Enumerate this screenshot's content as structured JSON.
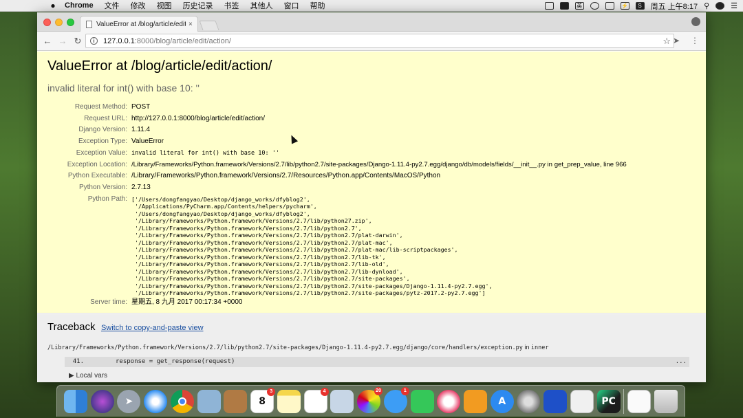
{
  "menubar": {
    "app": "Chrome",
    "items": [
      "文件",
      "修改",
      "视图",
      "历史记录",
      "书签",
      "其他人",
      "窗口",
      "帮助"
    ],
    "tray_ime": "英",
    "tray_battery": "⚡",
    "tray_s": "S",
    "clock": "周五 上午8:17"
  },
  "browser": {
    "tab_title": "ValueError at /blog/article/edit/",
    "tab_close": "×",
    "url_host": "127.0.0.1",
    "url_path": ":8000/blog/article/edit/action/"
  },
  "error": {
    "title": "ValueError at /blog/article/edit/action/",
    "subtitle": "invalid literal for int() with base 10: ''",
    "meta": [
      {
        "label": "Request Method:",
        "value": "POST"
      },
      {
        "label": "Request URL:",
        "value": "http://127.0.0.1:8000/blog/article/edit/action/"
      },
      {
        "label": "Django Version:",
        "value": "1.11.4"
      },
      {
        "label": "Exception Type:",
        "value": "ValueError"
      },
      {
        "label": "Exception Value:",
        "value": "invalid literal for int() with base 10: ''"
      },
      {
        "label": "Exception Location:",
        "value": "/Library/Frameworks/Python.framework/Versions/2.7/lib/python2.7/site-packages/Django-1.11.4-py2.7.egg/django/db/models/fields/__init__.py in get_prep_value, line 966"
      },
      {
        "label": "Python Executable:",
        "value": "/Library/Frameworks/Python.framework/Versions/2.7/Resources/Python.app/Contents/MacOS/Python"
      },
      {
        "label": "Python Version:",
        "value": "2.7.13"
      }
    ],
    "python_path_label": "Python Path:",
    "python_path": "['/Users/dongfangyao/Desktop/django_works/dfyblog2',\n '/Applications/PyCharm.app/Contents/helpers/pycharm',\n '/Users/dongfangyao/Desktop/django_works/dfyblog2',\n '/Library/Frameworks/Python.framework/Versions/2.7/lib/python27.zip',\n '/Library/Frameworks/Python.framework/Versions/2.7/lib/python2.7',\n '/Library/Frameworks/Python.framework/Versions/2.7/lib/python2.7/plat-darwin',\n '/Library/Frameworks/Python.framework/Versions/2.7/lib/python2.7/plat-mac',\n '/Library/Frameworks/Python.framework/Versions/2.7/lib/python2.7/plat-mac/lib-scriptpackages',\n '/Library/Frameworks/Python.framework/Versions/2.7/lib/python2.7/lib-tk',\n '/Library/Frameworks/Python.framework/Versions/2.7/lib/python2.7/lib-old',\n '/Library/Frameworks/Python.framework/Versions/2.7/lib/python2.7/lib-dynload',\n '/Library/Frameworks/Python.framework/Versions/2.7/lib/python2.7/site-packages',\n '/Library/Frameworks/Python.framework/Versions/2.7/lib/python2.7/site-packages/Django-1.11.4-py2.7.egg',\n '/Library/Frameworks/Python.framework/Versions/2.7/lib/python2.7/site-packages/pytz-2017.2-py2.7.egg']",
    "server_time_label": "Server time:",
    "server_time": "星期五, 8 九月 2017 00:17:34 +0000"
  },
  "traceback": {
    "heading": "Traceback",
    "switch_link": "Switch to copy-and-paste view",
    "file_path": "/Library/Frameworks/Python.framework/Versions/2.7/lib/python2.7/site-packages/Django-1.11.4-py2.7.egg/django/core/handlers/exception.py",
    "file_in": "in",
    "func": "inner",
    "line_number": "41.",
    "line_code": "response = get_response(request)",
    "line_more": "...",
    "local_vars": "▶ Local vars"
  },
  "dock": {
    "calendar_day": "8",
    "calendar_badge": "3",
    "reminders_badge": "4",
    "photos_badge": "20",
    "messages_badge": "1",
    "pycharm_label": "PC"
  }
}
